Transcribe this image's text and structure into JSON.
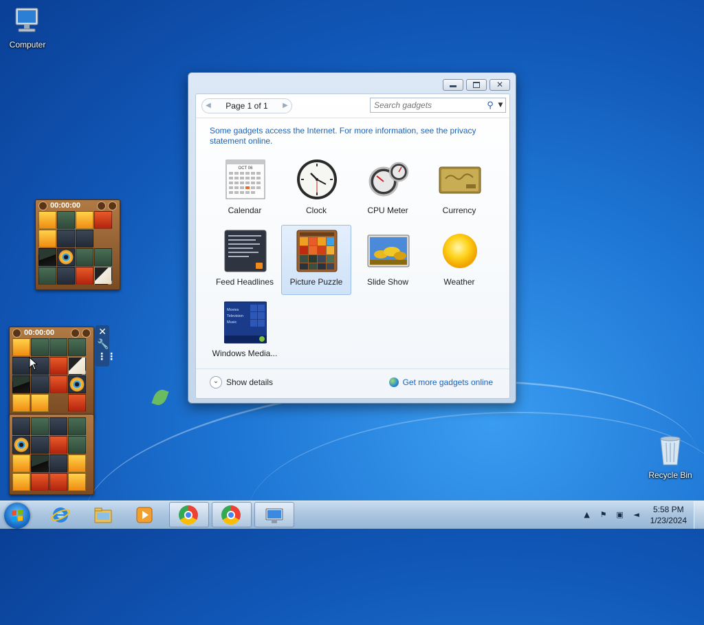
{
  "desktop": {
    "icons": [
      {
        "id": "computer",
        "label": "Computer",
        "icon": "computer-icon"
      },
      {
        "id": "recycle-bin",
        "label": "Recycle Bin",
        "icon": "recycle-bin-icon"
      }
    ],
    "puzzle_gadgets": [
      {
        "timer": "00:00:00"
      },
      {
        "timer": "00:00:00"
      }
    ],
    "gadget_tools": {
      "close": "✕",
      "options": "🔧",
      "drag": "⋮⋮"
    }
  },
  "gallery": {
    "pager": {
      "prev_icon": "◀",
      "text": "Page 1 of 1",
      "next_icon": "▶"
    },
    "search": {
      "placeholder": "Search gadgets"
    },
    "info_text": "Some gadgets access the Internet.  For more information, see the privacy statement online.",
    "gadgets": [
      {
        "label": "Calendar",
        "icon": "calendar-icon",
        "detail_text": "OCT 06"
      },
      {
        "label": "Clock",
        "icon": "clock-icon"
      },
      {
        "label": "CPU Meter",
        "icon": "cpu-meter-icon"
      },
      {
        "label": "Currency",
        "icon": "currency-icon"
      },
      {
        "label": "Feed Headlines",
        "icon": "feed-headlines-icon"
      },
      {
        "label": "Picture Puzzle",
        "icon": "picture-puzzle-icon",
        "selected": true
      },
      {
        "label": "Slide Show",
        "icon": "slide-show-icon"
      },
      {
        "label": "Weather",
        "icon": "weather-icon"
      },
      {
        "label": "Windows Media...",
        "icon": "windows-media-icon",
        "menu_lines": [
          "Movies",
          "Television",
          "Music"
        ]
      }
    ],
    "footer": {
      "show_details": "Show details",
      "get_more": "Get more gadgets online"
    }
  },
  "taskbar": {
    "pinned": [
      "internet-explorer-icon",
      "windows-explorer-icon",
      "media-player-icon",
      "chrome-icon",
      "chrome-icon",
      "remote-desktop-icon"
    ],
    "clock": {
      "time": "5:58 PM",
      "date": "1/23/2024"
    }
  }
}
